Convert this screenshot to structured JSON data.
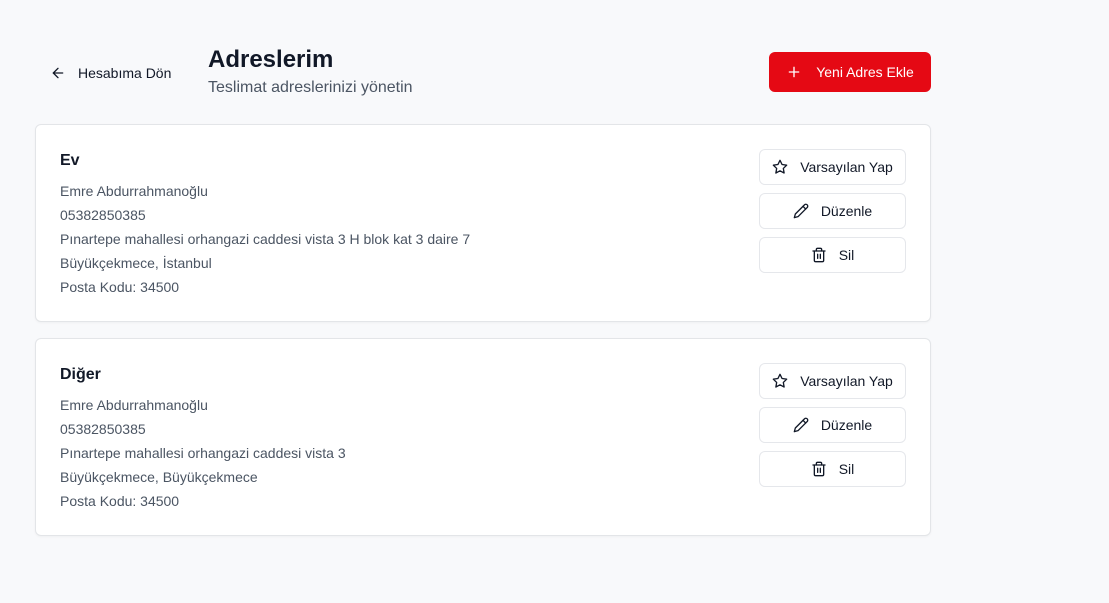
{
  "header": {
    "back_label": "Hesabıma Dön",
    "title": "Adreslerim",
    "subtitle": "Teslimat adreslerinizi yönetin",
    "add_button_label": "Yeni Adres Ekle"
  },
  "colors": {
    "accent": "#e50914",
    "background": "#f8f9fb"
  },
  "icons": {
    "back": "arrow-left-icon",
    "add": "plus-icon",
    "default": "star-icon",
    "edit": "pencil-icon",
    "delete": "trash-icon"
  },
  "addresses": [
    {
      "title": "Ev",
      "name": "Emre Abdurrahmanoğlu",
      "phone": "05382850385",
      "street": "Pınartepe mahallesi orhangazi caddesi vista 3 H blok kat 3 daire 7",
      "city": "Büyükçekmece, İstanbul",
      "postal": "Posta Kodu: 34500",
      "actions": {
        "set_default": "Varsayılan Yap",
        "edit": "Düzenle",
        "delete": "Sil"
      }
    },
    {
      "title": "Diğer",
      "name": "Emre Abdurrahmanoğlu",
      "phone": "05382850385",
      "street": "Pınartepe mahallesi orhangazi caddesi vista 3",
      "city": "Büyükçekmece, Büyükçekmece",
      "postal": "Posta Kodu: 34500",
      "actions": {
        "set_default": "Varsayılan Yap",
        "edit": "Düzenle",
        "delete": "Sil"
      }
    }
  ]
}
